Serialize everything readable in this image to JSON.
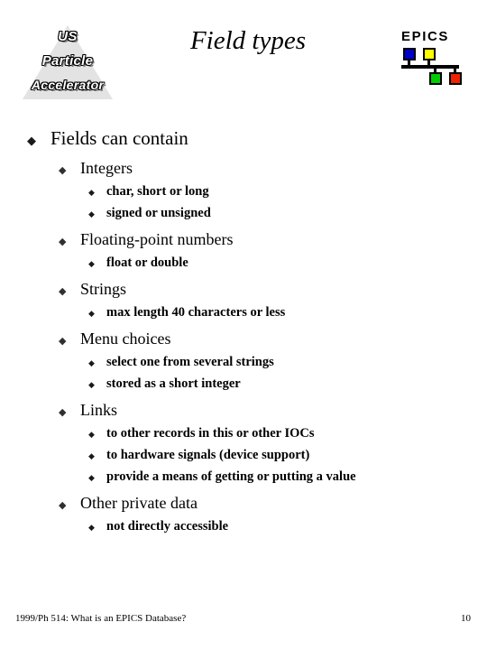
{
  "slide": {
    "title": "Field types",
    "page_number": "10",
    "footer_text": "1999/Ph 514: What is an EPICS Database?"
  },
  "uspas_logo": {
    "line1": "US",
    "line2": "Particle",
    "line3": "Accelerator",
    "triangle_color": "#e3e3e3"
  },
  "epics_logo": {
    "wordmark": "EPICS",
    "nodes": [
      {
        "name": "blue-node",
        "color": "#0000cc"
      },
      {
        "name": "yellow-node",
        "color": "#ffff00"
      },
      {
        "name": "green-node",
        "color": "#00cc00"
      },
      {
        "name": "red-node",
        "color": "#ee2200"
      }
    ]
  },
  "bullet_glyph": "◆",
  "content": {
    "level1": "Fields can contain",
    "groups": [
      {
        "heading": "Integers",
        "items": [
          "char, short or long",
          "signed or unsigned"
        ]
      },
      {
        "heading": "Floating-point numbers",
        "items": [
          "float or double"
        ]
      },
      {
        "heading": "Strings",
        "items": [
          "max length 40 characters or less"
        ]
      },
      {
        "heading": "Menu choices",
        "items": [
          "select one from several strings",
          "stored as a short integer"
        ]
      },
      {
        "heading": "Links",
        "items": [
          "to other records in this or other IOCs",
          "to hardware signals (device support)",
          "provide a means of getting or putting a value"
        ]
      },
      {
        "heading": "Other private data",
        "items": [
          "not directly accessible"
        ]
      }
    ]
  }
}
